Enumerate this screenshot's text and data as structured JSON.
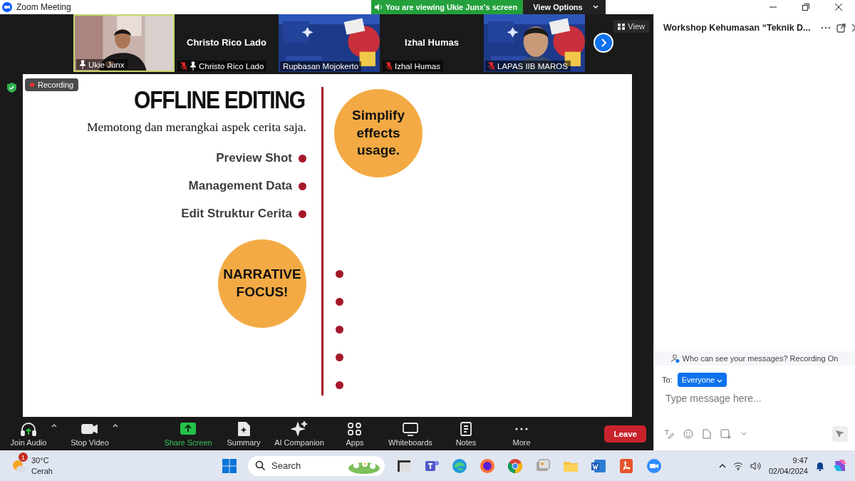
{
  "window": {
    "title": "Zoom Meeting"
  },
  "share_banner": {
    "text": "You are viewing Ukie Junx's screen",
    "button": "View Options"
  },
  "participants": [
    {
      "kind": "video-person",
      "name": "Ukie Junx",
      "muted": false,
      "pinned": true,
      "selected": true
    },
    {
      "kind": "name",
      "display": "Christo Rico Lado",
      "name": "Christo Rico Lado",
      "muted": true,
      "pinned": true,
      "selected": false
    },
    {
      "kind": "video-poster",
      "name": "Rupbasan Mojokerto",
      "muted": false,
      "pinned": false,
      "selected": false
    },
    {
      "kind": "name",
      "display": "Izhal Humas",
      "name": "Izhal Humas",
      "muted": true,
      "pinned": false,
      "selected": false
    },
    {
      "kind": "video-poster-person",
      "name": "LAPAS IIB MAROS",
      "muted": true,
      "pinned": false,
      "selected": false
    }
  ],
  "view_button": "View",
  "recording": "Recording",
  "slide": {
    "title": "OFFLINE EDITING",
    "subtitle": "Memotong dan merangkai aspek cerita saja.",
    "points": [
      "Preview Shot",
      "Management Data",
      "Edit Struktur Cerita"
    ],
    "left_circle": "NARRATIVE FOCUS!",
    "right_circle": "Simplify effects usage."
  },
  "toolbar": [
    {
      "kind": "headphones",
      "label": "Join Audio",
      "caret": true,
      "highlighted": false
    },
    {
      "kind": "camera",
      "label": "Stop Video",
      "caret": true,
      "highlighted": false
    },
    {
      "kind": "share",
      "label": "Share Screen",
      "caret": false,
      "highlighted": true
    },
    {
      "kind": "summary",
      "label": "Summary",
      "caret": false,
      "highlighted": false
    },
    {
      "kind": "sparkle",
      "label": "AI Companion",
      "caret": false,
      "highlighted": false
    },
    {
      "kind": "apps",
      "label": "Apps",
      "caret": false,
      "highlighted": false
    },
    {
      "kind": "whiteboard",
      "label": "Whiteboards",
      "caret": false,
      "highlighted": false
    },
    {
      "kind": "notes",
      "label": "Notes",
      "caret": false,
      "highlighted": false
    },
    {
      "kind": "more",
      "label": "More",
      "caret": false,
      "highlighted": false
    }
  ],
  "leave": "Leave",
  "chat": {
    "title": "Workshop Kehumasan “Teknik D...",
    "notice": "Who can see your messages? Recording On",
    "to_label": "To:",
    "recipient": "Everyone",
    "placeholder": "Type message here..."
  },
  "taskbar": {
    "weather": {
      "badge": "1",
      "temp": "30°C",
      "condition": "Cerah"
    },
    "search_placeholder": "Search",
    "apps": [
      {
        "kind": "explorer-dark"
      },
      {
        "kind": "teams"
      },
      {
        "kind": "edge"
      },
      {
        "kind": "firefox"
      },
      {
        "kind": "chrome"
      },
      {
        "kind": "gallery"
      },
      {
        "kind": "folder"
      },
      {
        "kind": "word"
      },
      {
        "kind": "acrobat"
      },
      {
        "kind": "zoom"
      }
    ],
    "time": "9:47",
    "date": "02/04/2024"
  }
}
